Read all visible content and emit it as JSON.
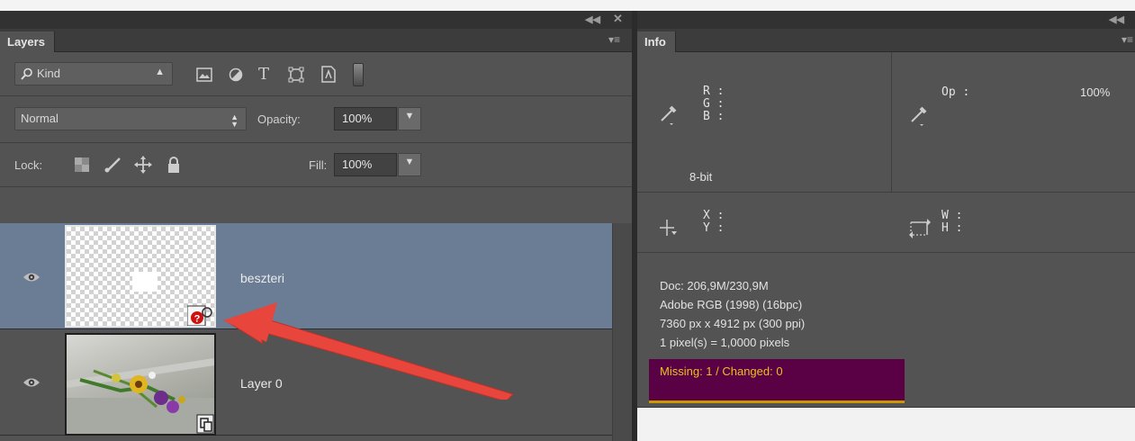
{
  "layers_panel": {
    "tab": "Layers",
    "filter": {
      "label": "Kind"
    },
    "blend_mode": "Normal",
    "opacity": {
      "label": "Opacity:",
      "value": "100%"
    },
    "lock": {
      "label": "Lock:"
    },
    "fill": {
      "label": "Fill:",
      "value": "100%"
    },
    "layers": [
      {
        "name": "beszteri",
        "selected": true,
        "status": "missing-link"
      },
      {
        "name": "Layer 0",
        "selected": false
      }
    ]
  },
  "info_panel": {
    "tab": "Info",
    "rgb": {
      "r": "R :",
      "g": "G :",
      "b": "B :",
      "bit_depth": "8-bit"
    },
    "opacity": {
      "label": "Op :",
      "value": "100%"
    },
    "position": {
      "x": "X :",
      "y": "Y :"
    },
    "size": {
      "w": "W :",
      "h": "H :"
    },
    "doc_lines": [
      "Doc: 206,9M/230,9M",
      "Adobe RGB (1998) (16bpc)",
      "7360 px x 4912 px (300 ppi)",
      "1 pixel(s) = 1,0000 pixels"
    ],
    "missing_changed": "Missing: 1 / Changed: 0"
  },
  "colors": {
    "panel_bg": "#535353",
    "selected_layer": "#6a7d95",
    "annotation_arrow": "#e8453c",
    "highlight_bg": "#5a0044",
    "missing_text": "#e8c020",
    "warning_badge": "#cc1111"
  },
  "icons": [
    "search-icon",
    "image-filter-icon",
    "adjustment-filter-icon",
    "type-filter-icon",
    "shape-filter-icon",
    "smart-object-filter-icon",
    "filter-toggle-icon",
    "lock-transparent-icon",
    "lock-brush-icon",
    "lock-position-icon",
    "lock-all-icon",
    "eye-icon",
    "warning-badge-icon",
    "smart-object-badge-icon",
    "eyedropper-icon",
    "crosshair-icon",
    "marquee-size-icon",
    "panel-collapse-icon",
    "panel-close-icon",
    "panel-menu-icon",
    "annotation-arrow"
  ]
}
